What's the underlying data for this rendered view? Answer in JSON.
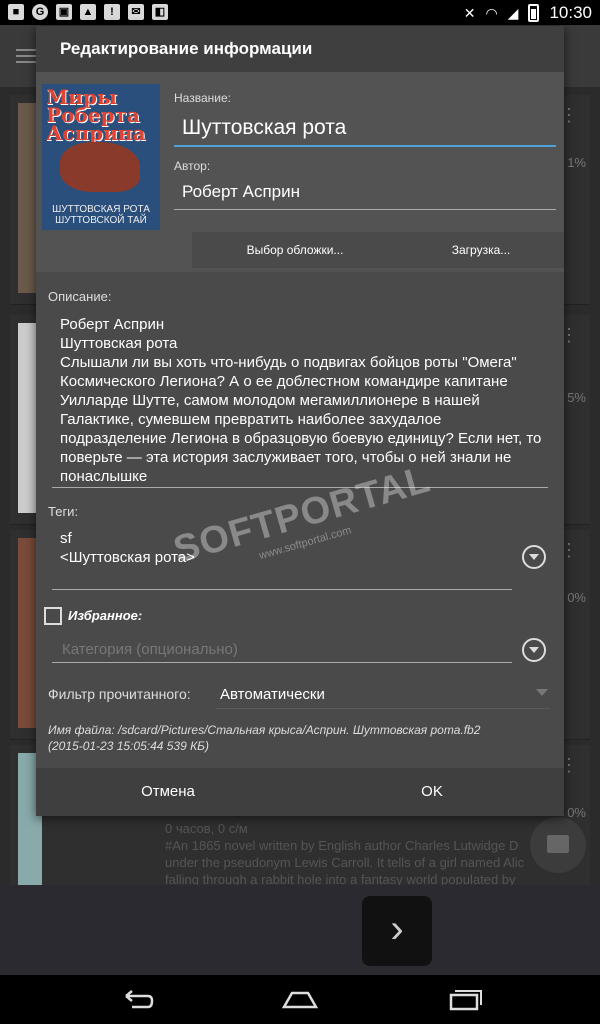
{
  "status_bar": {
    "time": "10:30"
  },
  "background_app": {
    "rows": [
      {
        "percent": "1%"
      },
      {
        "percent": "5%"
      },
      {
        "percent": "0%"
      },
      {
        "percent": "0%"
      }
    ],
    "last_row_text": "0 часов, 0 с/м\n#An 1865 novel written by English author Charles Lutwidge D\nunder the pseudonym Lewis Carroll. It tells of a girl named Alic\nfalling through a rabbit hole into a fantasy world populated by"
  },
  "dialog": {
    "title": "Редактирование информации",
    "cover": {
      "title_text": "Миры Роберта Асприна",
      "subtitle_text": "ШУТТОВСКАЯ РОТА\nШУТТОВСКОЙ ТАЙ"
    },
    "name_label": "Название:",
    "name_value": "Шуттовская рота",
    "author_label": "Автор:",
    "author_value": "Роберт Асприн",
    "choose_cover_button": "Выбор обложки...",
    "load_button": "Загрузка...",
    "description_label": "Описание:",
    "description_value": "Роберт Асприн\nШуттовская рота\nСлышали ли вы хоть что-нибудь о подвигах бойцов роты \"Омега\" Космического Легиона? А о ее доблестном командире капитане Уилларде Шутте, самом молодом мегамиллионере в нашей Галактике, сумевшем превратить наиболее захудалое подразделение Легиона в образцовую боевую единицу? Если нет, то поверьте — эта история заслуживает того, чтобы о ней знали не понаслышке",
    "tags_label": "Теги:",
    "tags_value": "sf\n<Шуттовская рота>",
    "favorite_label": "Избранное:",
    "favorite_checked": false,
    "category_placeholder": "Категория (опционально)",
    "filter_label": "Фильтр прочитанного:",
    "filter_value": "Автоматически",
    "file_info": "Имя файла: /sdcard/Pictures/Стальная крыса/Асприн. Шуттовская рота.fb2\n(2015-01-23 15:05:44  539 КБ)",
    "cancel_button": "Отмена",
    "ok_button": "OK"
  },
  "watermark": {
    "logo": "SOFTPORTAL",
    "url": "www.softportal.com"
  },
  "colors": {
    "accent": "#4da3d8",
    "dialog_bg": "#4a4a4a",
    "header_bg": "#3f3f3f"
  }
}
